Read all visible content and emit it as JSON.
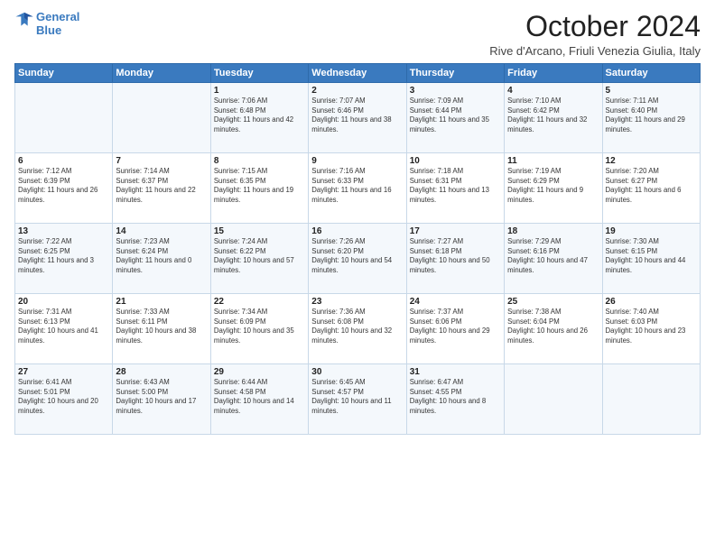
{
  "header": {
    "logo_line1": "General",
    "logo_line2": "Blue",
    "month_title": "October 2024",
    "location": "Rive d'Arcano, Friuli Venezia Giulia, Italy"
  },
  "weekdays": [
    "Sunday",
    "Monday",
    "Tuesday",
    "Wednesday",
    "Thursday",
    "Friday",
    "Saturday"
  ],
  "weeks": [
    [
      {
        "day": "",
        "text": ""
      },
      {
        "day": "",
        "text": ""
      },
      {
        "day": "1",
        "text": "Sunrise: 7:06 AM\nSunset: 6:48 PM\nDaylight: 11 hours and 42 minutes."
      },
      {
        "day": "2",
        "text": "Sunrise: 7:07 AM\nSunset: 6:46 PM\nDaylight: 11 hours and 38 minutes."
      },
      {
        "day": "3",
        "text": "Sunrise: 7:09 AM\nSunset: 6:44 PM\nDaylight: 11 hours and 35 minutes."
      },
      {
        "day": "4",
        "text": "Sunrise: 7:10 AM\nSunset: 6:42 PM\nDaylight: 11 hours and 32 minutes."
      },
      {
        "day": "5",
        "text": "Sunrise: 7:11 AM\nSunset: 6:40 PM\nDaylight: 11 hours and 29 minutes."
      }
    ],
    [
      {
        "day": "6",
        "text": "Sunrise: 7:12 AM\nSunset: 6:39 PM\nDaylight: 11 hours and 26 minutes."
      },
      {
        "day": "7",
        "text": "Sunrise: 7:14 AM\nSunset: 6:37 PM\nDaylight: 11 hours and 22 minutes."
      },
      {
        "day": "8",
        "text": "Sunrise: 7:15 AM\nSunset: 6:35 PM\nDaylight: 11 hours and 19 minutes."
      },
      {
        "day": "9",
        "text": "Sunrise: 7:16 AM\nSunset: 6:33 PM\nDaylight: 11 hours and 16 minutes."
      },
      {
        "day": "10",
        "text": "Sunrise: 7:18 AM\nSunset: 6:31 PM\nDaylight: 11 hours and 13 minutes."
      },
      {
        "day": "11",
        "text": "Sunrise: 7:19 AM\nSunset: 6:29 PM\nDaylight: 11 hours and 9 minutes."
      },
      {
        "day": "12",
        "text": "Sunrise: 7:20 AM\nSunset: 6:27 PM\nDaylight: 11 hours and 6 minutes."
      }
    ],
    [
      {
        "day": "13",
        "text": "Sunrise: 7:22 AM\nSunset: 6:25 PM\nDaylight: 11 hours and 3 minutes."
      },
      {
        "day": "14",
        "text": "Sunrise: 7:23 AM\nSunset: 6:24 PM\nDaylight: 11 hours and 0 minutes."
      },
      {
        "day": "15",
        "text": "Sunrise: 7:24 AM\nSunset: 6:22 PM\nDaylight: 10 hours and 57 minutes."
      },
      {
        "day": "16",
        "text": "Sunrise: 7:26 AM\nSunset: 6:20 PM\nDaylight: 10 hours and 54 minutes."
      },
      {
        "day": "17",
        "text": "Sunrise: 7:27 AM\nSunset: 6:18 PM\nDaylight: 10 hours and 50 minutes."
      },
      {
        "day": "18",
        "text": "Sunrise: 7:29 AM\nSunset: 6:16 PM\nDaylight: 10 hours and 47 minutes."
      },
      {
        "day": "19",
        "text": "Sunrise: 7:30 AM\nSunset: 6:15 PM\nDaylight: 10 hours and 44 minutes."
      }
    ],
    [
      {
        "day": "20",
        "text": "Sunrise: 7:31 AM\nSunset: 6:13 PM\nDaylight: 10 hours and 41 minutes."
      },
      {
        "day": "21",
        "text": "Sunrise: 7:33 AM\nSunset: 6:11 PM\nDaylight: 10 hours and 38 minutes."
      },
      {
        "day": "22",
        "text": "Sunrise: 7:34 AM\nSunset: 6:09 PM\nDaylight: 10 hours and 35 minutes."
      },
      {
        "day": "23",
        "text": "Sunrise: 7:36 AM\nSunset: 6:08 PM\nDaylight: 10 hours and 32 minutes."
      },
      {
        "day": "24",
        "text": "Sunrise: 7:37 AM\nSunset: 6:06 PM\nDaylight: 10 hours and 29 minutes."
      },
      {
        "day": "25",
        "text": "Sunrise: 7:38 AM\nSunset: 6:04 PM\nDaylight: 10 hours and 26 minutes."
      },
      {
        "day": "26",
        "text": "Sunrise: 7:40 AM\nSunset: 6:03 PM\nDaylight: 10 hours and 23 minutes."
      }
    ],
    [
      {
        "day": "27",
        "text": "Sunrise: 6:41 AM\nSunset: 5:01 PM\nDaylight: 10 hours and 20 minutes."
      },
      {
        "day": "28",
        "text": "Sunrise: 6:43 AM\nSunset: 5:00 PM\nDaylight: 10 hours and 17 minutes."
      },
      {
        "day": "29",
        "text": "Sunrise: 6:44 AM\nSunset: 4:58 PM\nDaylight: 10 hours and 14 minutes."
      },
      {
        "day": "30",
        "text": "Sunrise: 6:45 AM\nSunset: 4:57 PM\nDaylight: 10 hours and 11 minutes."
      },
      {
        "day": "31",
        "text": "Sunrise: 6:47 AM\nSunset: 4:55 PM\nDaylight: 10 hours and 8 minutes."
      },
      {
        "day": "",
        "text": ""
      },
      {
        "day": "",
        "text": ""
      }
    ]
  ]
}
